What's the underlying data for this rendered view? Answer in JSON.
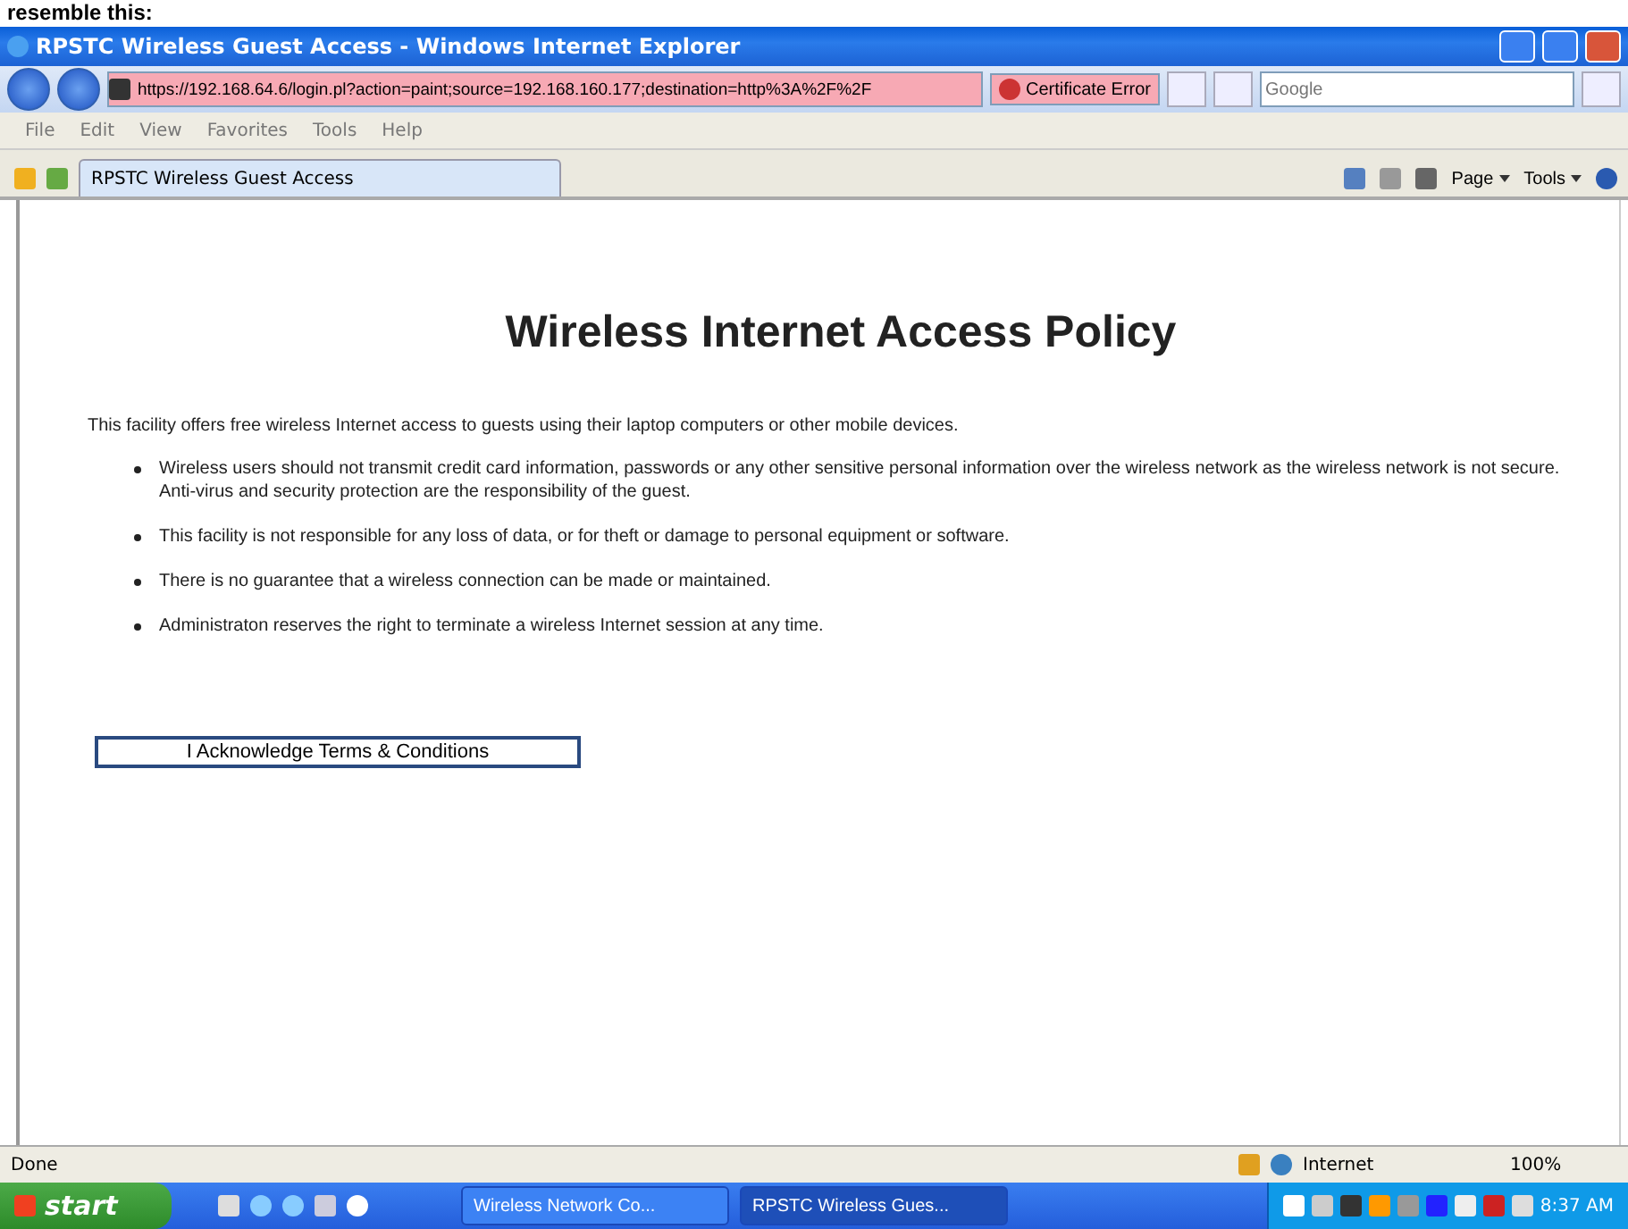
{
  "caption": "resemble this:",
  "window": {
    "title": "RPSTC Wireless Guest Access - Windows Internet Explorer"
  },
  "address_bar": {
    "url": "https://192.168.64.6/login.pl?action=paint;source=192.168.160.177;destination=http%3A%2F%2F",
    "certificate": "Certificate Error",
    "search_placeholder": "Google"
  },
  "menu": [
    "File",
    "Edit",
    "View",
    "Favorites",
    "Tools",
    "Help"
  ],
  "tabs": [
    {
      "label": "RPSTC Wireless Guest Access",
      "selected": true
    }
  ],
  "command_bar": [
    "Page",
    "Tools"
  ],
  "page": {
    "heading": "Wireless Internet Access Policy",
    "intro": "This facility offers free wireless Internet access to guests using their laptop computers or other mobile devices.",
    "bullets": [
      "Wireless users should not transmit credit card information, passwords or any other sensitive personal information over the wireless network as the wireless network is not secure. Anti-virus and security protection are the responsibility of the guest.",
      "This facility is not responsible for any loss of data, or for theft or damage to personal equipment or software.",
      "There is no guarantee that a wireless connection can be made or maintained.",
      "Administraton reserves the right to terminate a wireless Internet session at any time."
    ],
    "button": "I Acknowledge Terms & Conditions"
  },
  "status_bar": {
    "text": "Done",
    "zone": "Internet",
    "zoom": "100%"
  },
  "taskbar": {
    "start": "start",
    "tasks": [
      {
        "label": "Wireless Network Co...",
        "selected": false
      },
      {
        "label": "RPSTC Wireless Gues...",
        "selected": true
      }
    ],
    "clock": "8:37 AM"
  }
}
